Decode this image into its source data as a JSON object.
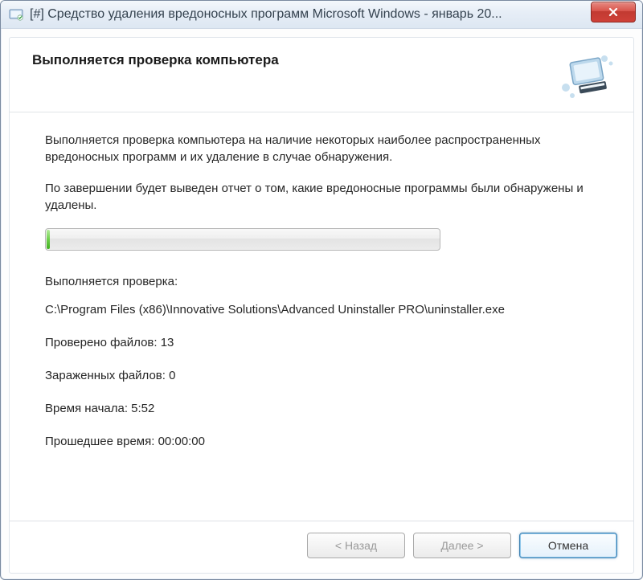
{
  "window": {
    "title": "[#] Средство удаления вредоносных программ Microsoft Windows -  январь 20..."
  },
  "header": {
    "heading": "Выполняется проверка компьютера"
  },
  "body": {
    "desc1": "Выполняется проверка компьютера на наличие некоторых наиболее распространенных вредоносных программ и их удаление в случае обнаружения.",
    "desc2": "По завершении будет выведен отчет о том, какие вредоносные программы были обнаружены и удалены."
  },
  "status": {
    "checking_label": "Выполняется проверка:",
    "current_path": "C:\\Program Files (x86)\\Innovative Solutions\\Advanced Uninstaller PRO\\uninstaller.exe",
    "files_checked": "Проверено файлов: 13",
    "infected_files": "Зараженных файлов: 0",
    "start_time": "Время начала: 5:52",
    "elapsed": "Прошедшее время: 00:00:00"
  },
  "buttons": {
    "back": "< Назад",
    "next": "Далее >",
    "cancel": "Отмена"
  }
}
